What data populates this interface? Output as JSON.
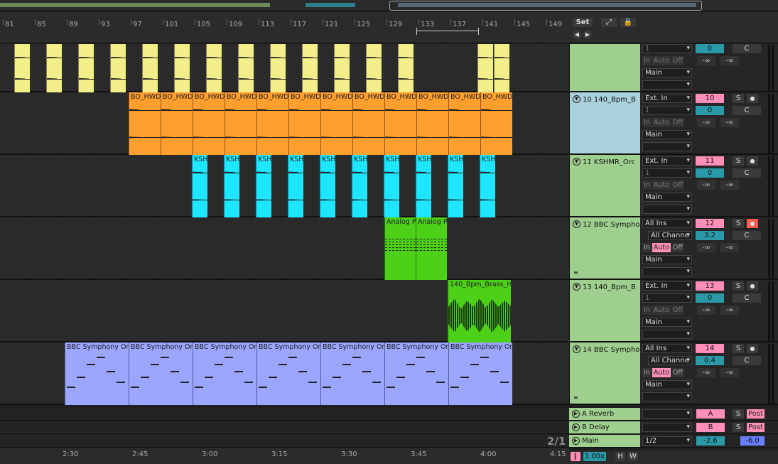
{
  "ruler": {
    "bars": [
      "81",
      "85",
      "89",
      "93",
      "97",
      "101",
      "105",
      "109",
      "113",
      "117",
      "121",
      "125",
      "129",
      "133",
      "137",
      "141",
      "145",
      "149"
    ]
  },
  "toolbar": {
    "set_label": "Set",
    "expand_icon": "expand-icon",
    "lock_icon": "lock-icon"
  },
  "tracks": [
    {
      "id": "top",
      "name": "",
      "color": "#f2ee8a",
      "header_color": "#9fcf8f",
      "input": "",
      "channel": "1",
      "monitor": [
        "In",
        "Auto",
        "Off"
      ],
      "output": "Main",
      "number": "",
      "vol": "0",
      "pan": "C",
      "send_a": "-∞",
      "send_b": "-∞",
      "clips": []
    },
    {
      "id": "t10",
      "name": "10 140_Bpm_B",
      "color": "#ff9f2e",
      "header_color": "#a8d1dc",
      "input": "Ext. In",
      "channel": "1",
      "monitor": [
        "In",
        "Auto",
        "Off"
      ],
      "output": "Main",
      "number": "10",
      "vol": "0",
      "pan": "C",
      "send_a": "-∞",
      "send_b": "-∞",
      "clip_label": "BO_HWD"
    },
    {
      "id": "t11",
      "name": "11 KSHMR_Orc",
      "color": "#1ee6ff",
      "header_color": "#9fcf8f",
      "input": "Ext. In",
      "channel": "1",
      "monitor": [
        "In",
        "Auto",
        "Off"
      ],
      "output": "Main",
      "number": "11",
      "vol": "0",
      "pan": "C",
      "send_a": "-∞",
      "send_b": "-∞",
      "clip_label": "KSH"
    },
    {
      "id": "t12",
      "name": "12 BBC Sympho",
      "color": "#4cd018",
      "header_color": "#9fcf8f",
      "input": "All Ins",
      "channel": "All Channe",
      "monitor": [
        "In",
        "Auto",
        "Off"
      ],
      "output": "Main",
      "number": "12",
      "vol": "3.2",
      "pan": "C",
      "send_a": "-∞",
      "send_b": "-∞",
      "clip_label": "Analog P"
    },
    {
      "id": "t13",
      "name": "13 140_Bpm_B",
      "color": "#4cd018",
      "header_color": "#9fcf8f",
      "input": "Ext. In",
      "channel": "1",
      "monitor": [
        "In",
        "Auto",
        "Off"
      ],
      "output": "Main",
      "number": "13",
      "vol": "0",
      "pan": "C",
      "send_a": "-∞",
      "send_b": "-∞",
      "clip_label": "140_Bpm_Brass_H"
    },
    {
      "id": "t14",
      "name": "14 BBC Sympho",
      "color": "#9aa6ff",
      "header_color": "#9fcf8f",
      "input": "All Ins",
      "channel": "All Channe",
      "monitor": [
        "In",
        "Auto",
        "Off"
      ],
      "output": "Main",
      "number": "14",
      "vol": "0.4",
      "pan": "C",
      "send_a": "-∞",
      "send_b": "-∞",
      "clip_label": "BBC Symphony Or"
    }
  ],
  "returns": [
    {
      "name": "A Reverb",
      "tag": "A",
      "solo": "S",
      "post": "Post"
    },
    {
      "name": "B Delay",
      "tag": "B",
      "solo": "S",
      "post": "Post"
    },
    {
      "name": "Main",
      "tag": "1/2",
      "vol": "-2.6",
      "pan": "-6.0"
    }
  ],
  "page_indicator": "2/1",
  "timeline": {
    "times": [
      "2:30",
      "2:45",
      "3:00",
      "3:15",
      "3:30",
      "3:45",
      "4:00",
      "4:15"
    ]
  },
  "status": {
    "zoom": "1.00x",
    "h": "H",
    "w": "W"
  }
}
